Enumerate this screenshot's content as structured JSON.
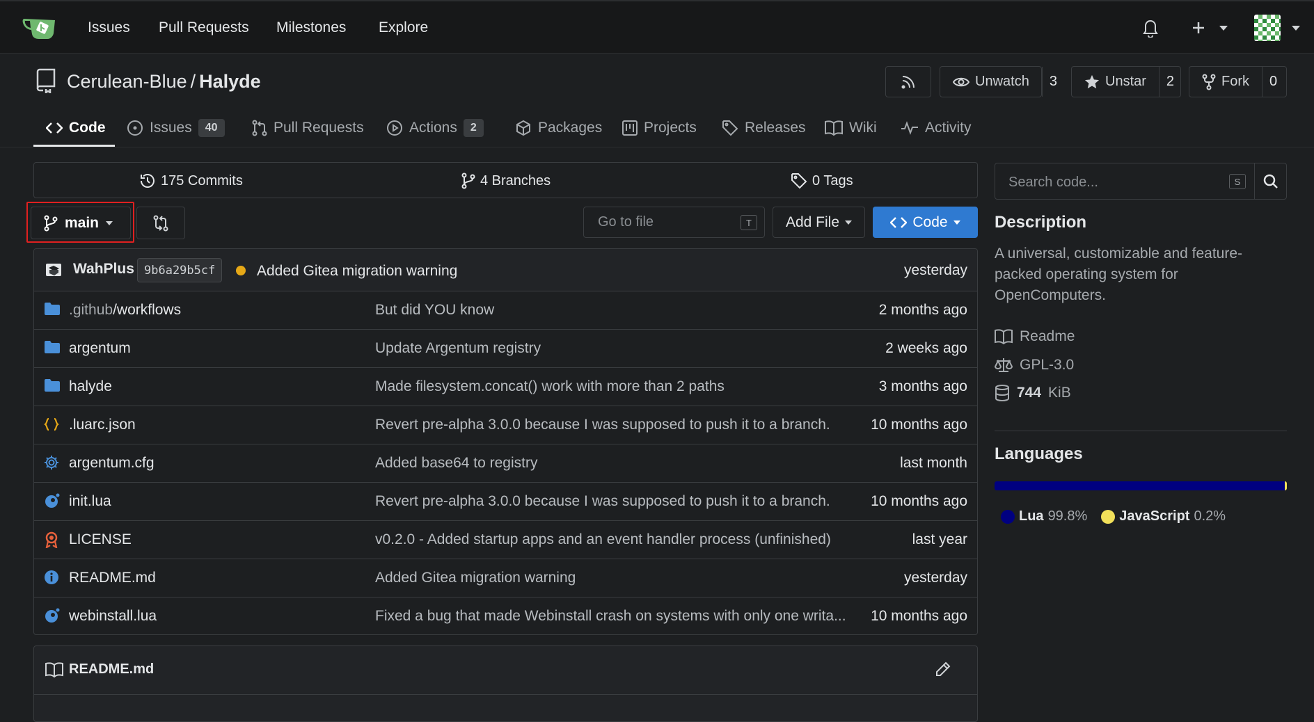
{
  "nav": {
    "links": [
      "Issues",
      "Pull Requests",
      "Milestones",
      "Explore"
    ]
  },
  "repo": {
    "owner": "Cerulean-Blue",
    "separator": "/",
    "name": "Halyde",
    "unwatch_label": "Unwatch",
    "watch_count": "3",
    "unstar_label": "Unstar",
    "star_count": "2",
    "fork_label": "Fork",
    "fork_count": "0"
  },
  "tabs": [
    {
      "label": "Code"
    },
    {
      "label": "Issues",
      "badge": "40"
    },
    {
      "label": "Pull Requests"
    },
    {
      "label": "Actions",
      "badge": "2"
    },
    {
      "label": "Packages"
    },
    {
      "label": "Projects"
    },
    {
      "label": "Releases"
    },
    {
      "label": "Wiki"
    },
    {
      "label": "Activity"
    }
  ],
  "stats": {
    "commits": "175 Commits",
    "branches": "4 Branches",
    "tags": "0 Tags"
  },
  "toolbar": {
    "branch": "main",
    "goto_placeholder": "Go to file",
    "goto_key": "T",
    "add_file": "Add File",
    "code": "Code"
  },
  "latest_commit": {
    "author": "WahPlus",
    "sha": "9b6a29b5cf",
    "message": "Added Gitea migration warning",
    "time": "yesterday",
    "status_color": "#e6a817"
  },
  "files": [
    {
      "name_dim": ".github",
      "name": "/workflows",
      "type": "folder",
      "message": "But did YOU know",
      "time": "2 months ago"
    },
    {
      "name_dim": "",
      "name": "argentum",
      "type": "folder",
      "message": "Update Argentum registry",
      "time": "2 weeks ago"
    },
    {
      "name_dim": "",
      "name": "halyde",
      "type": "folder",
      "message": "Made filesystem.concat() work with more than 2 paths",
      "time": "3 months ago"
    },
    {
      "name_dim": "",
      "name": ".luarc.json",
      "type": "json",
      "message": "Revert pre-alpha 3.0.0 because I was supposed to push it to a branch.",
      "time": "10 months ago"
    },
    {
      "name_dim": "",
      "name": "argentum.cfg",
      "type": "config",
      "message": "Added base64 to registry",
      "time": "last month"
    },
    {
      "name_dim": "",
      "name": "init.lua",
      "type": "lua",
      "message": "Revert pre-alpha 3.0.0 because I was supposed to push it to a branch.",
      "time": "10 months ago"
    },
    {
      "name_dim": "",
      "name": "LICENSE",
      "type": "license",
      "message": "v0.2.0 - Added startup apps and an event handler process (unfinished)",
      "time": "last year"
    },
    {
      "name_dim": "",
      "name": "README.md",
      "type": "info",
      "message": "Added Gitea migration warning",
      "time": "yesterday"
    },
    {
      "name_dim": "",
      "name": "webinstall.lua",
      "type": "lua",
      "message": "Fixed a bug that made Webinstall crash on systems with only one writa...",
      "time": "10 months ago"
    }
  ],
  "readme": {
    "title": "README.md"
  },
  "sidebar": {
    "search_placeholder": "Search code...",
    "search_key": "S",
    "description_heading": "Description",
    "description": "A universal, customizable and feature-packed operating system for OpenComputers.",
    "readme_link": "Readme",
    "license": "GPL-3.0",
    "size_value": "744",
    "size_unit": "KiB",
    "languages_heading": "Languages",
    "languages": [
      {
        "name": "Lua",
        "percent": "99.8%",
        "fraction": 0.998,
        "color": "#000080"
      },
      {
        "name": "JavaScript",
        "percent": "0.2%",
        "fraction": 0.002,
        "color": "#f1e05a"
      }
    ]
  },
  "colors": {
    "accent": "#2f7ad1",
    "highlight": "#e02020"
  }
}
